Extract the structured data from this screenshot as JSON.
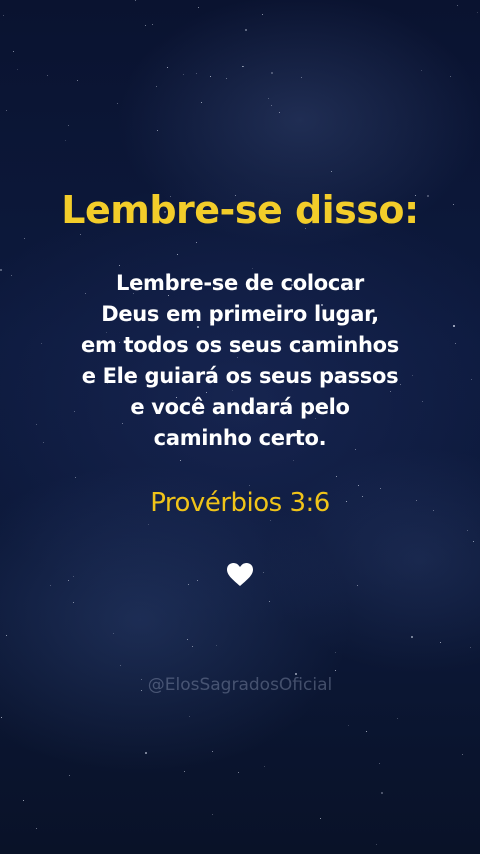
{
  "title": "Lembre-se disso:",
  "message_lines": [
    "Lembre-se de colocar",
    "Deus em primeiro lugar,",
    "em todos os seus caminhos",
    "e Ele guiará os seus passos",
    "e você andará pelo",
    "caminho certo."
  ],
  "reference": "Provérbios 3:6",
  "watermark": "@ElosSagradosOficial",
  "icons": {
    "heart": "heart-icon"
  },
  "colors": {
    "title": "#f3cd2a",
    "reference": "#f0c419",
    "text": "#ffffff",
    "background": "#0b1532"
  }
}
